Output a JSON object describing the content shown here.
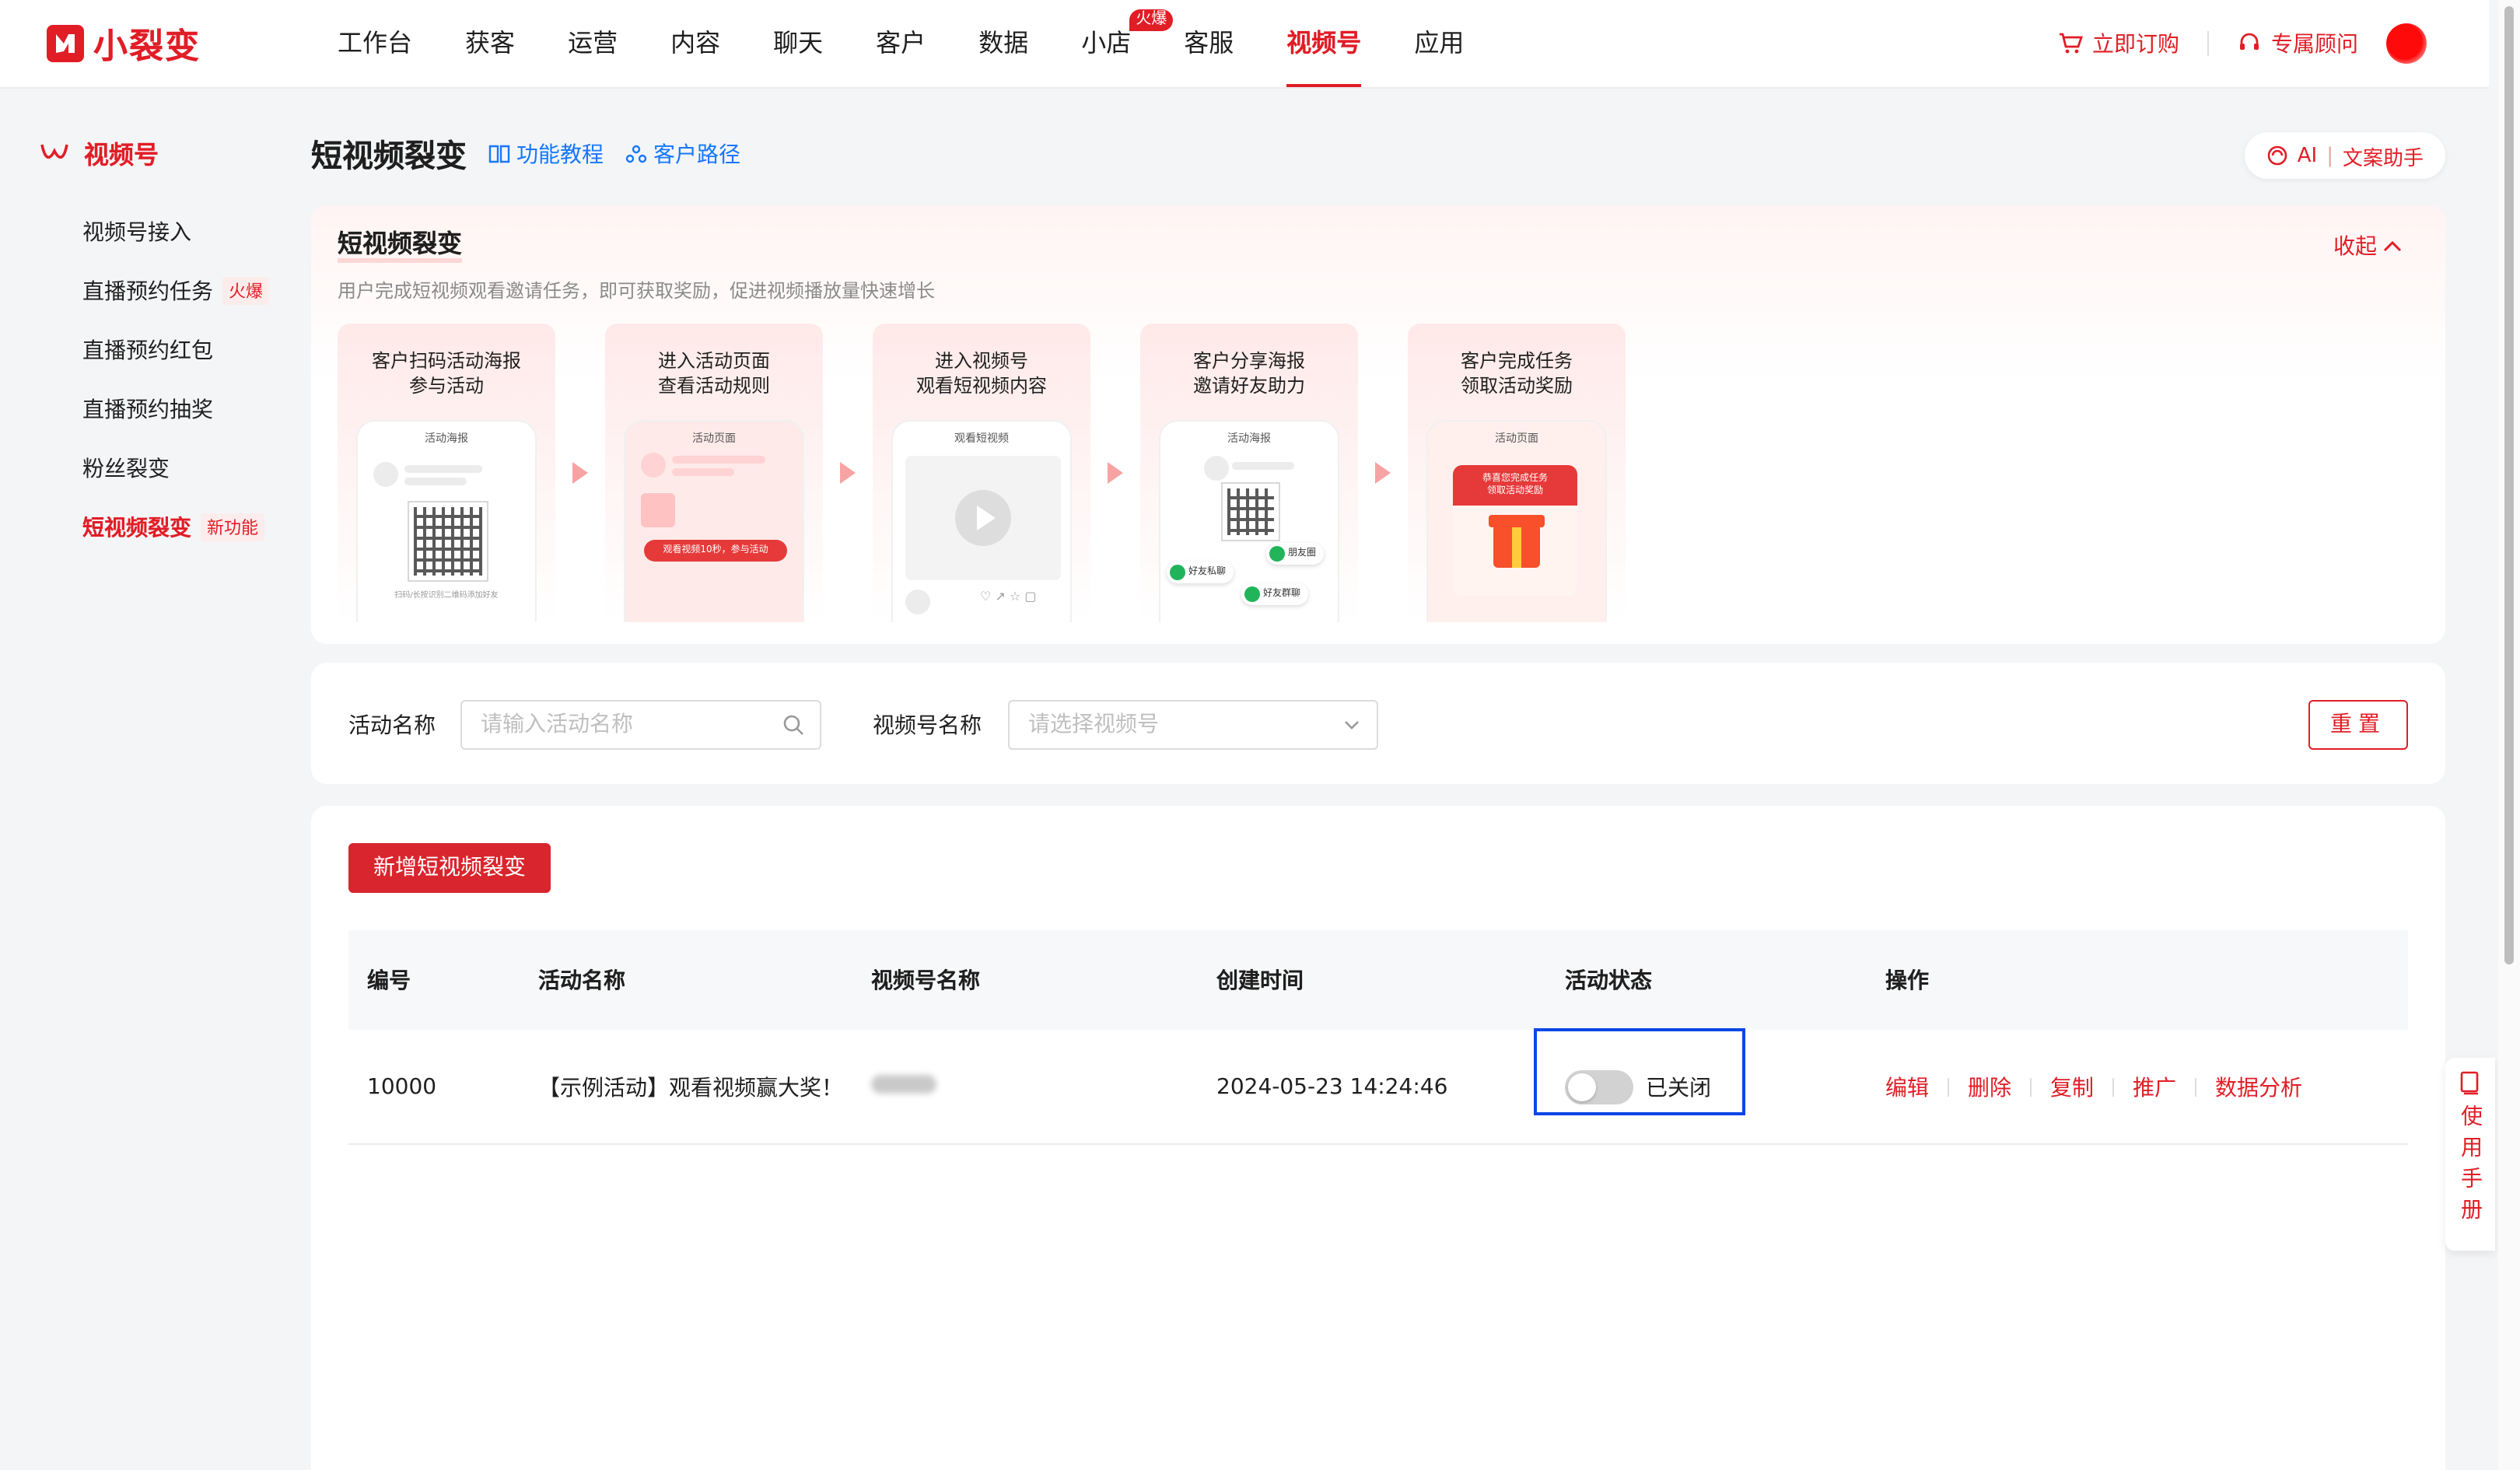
{
  "brand": {
    "logo_text": "小裂变",
    "accent": "#e11d26"
  },
  "nav": {
    "items": [
      {
        "label": "工作台"
      },
      {
        "label": "获客"
      },
      {
        "label": "运营"
      },
      {
        "label": "内容"
      },
      {
        "label": "聊天"
      },
      {
        "label": "客户"
      },
      {
        "label": "数据"
      },
      {
        "label": "小店",
        "badge": "火爆"
      },
      {
        "label": "客服"
      },
      {
        "label": "视频号",
        "active": true
      },
      {
        "label": "应用"
      }
    ],
    "subscribe": "立即订购",
    "advisor": "专属顾问"
  },
  "sidebar": {
    "title": "视频号",
    "items": [
      {
        "label": "视频号接入"
      },
      {
        "label": "直播预约任务",
        "tag": "火爆"
      },
      {
        "label": "直播预约红包"
      },
      {
        "label": "直播预约抽奖"
      },
      {
        "label": "粉丝裂变"
      },
      {
        "label": "短视频裂变",
        "tag": "新功能",
        "active": true
      }
    ]
  },
  "header": {
    "title": "短视频裂变",
    "tutorial": "功能教程",
    "path": "客户路径",
    "ai_ai": "AI",
    "ai_label": "文案助手"
  },
  "intro": {
    "title": "短视频裂变",
    "desc": "用户完成短视频观看邀请任务，即可获取奖励，促进视频播放量快速增长",
    "collapse": "收起",
    "steps": [
      {
        "line1": "客户扫码活动海报",
        "line2": "参与活动",
        "cap": "活动海报",
        "foot": "扫码/长按识别二维码添加好友"
      },
      {
        "line1": "进入活动页面",
        "line2": "查看活动规则",
        "cap": "活动页面",
        "pill": "观看视频10秒，参与活动"
      },
      {
        "line1": "进入视频号",
        "line2": "观看短视频内容",
        "cap": "观看短视频"
      },
      {
        "line1": "客户分享海报",
        "line2": "邀请好友助力",
        "cap": "活动海报",
        "chip1": "朋友圈",
        "chip2": "好友私聊",
        "chip3": "好友群聊"
      },
      {
        "line1": "客户完成任务",
        "line2": "领取活动奖励",
        "cap": "活动页面",
        "reward1": "恭喜您完成任务",
        "reward2": "领取活动奖励"
      }
    ]
  },
  "filter": {
    "name_label": "活动名称",
    "name_placeholder": "请输入活动名称",
    "channel_label": "视频号名称",
    "channel_placeholder": "请选择视频号",
    "reset": "重置"
  },
  "list": {
    "add_button": "新增短视频裂变",
    "columns": [
      "编号",
      "活动名称",
      "视频号名称",
      "创建时间",
      "活动状态",
      "操作"
    ],
    "rows": [
      {
        "id": "10000",
        "name": "【示例活动】观看视频赢大奖！",
        "created": "2024-05-23 14:24:46",
        "status": "已关闭",
        "enabled": false,
        "ops": [
          "编辑",
          "删除",
          "复制",
          "推广",
          "数据分析"
        ]
      }
    ]
  },
  "manual": {
    "label": "使用手册"
  }
}
